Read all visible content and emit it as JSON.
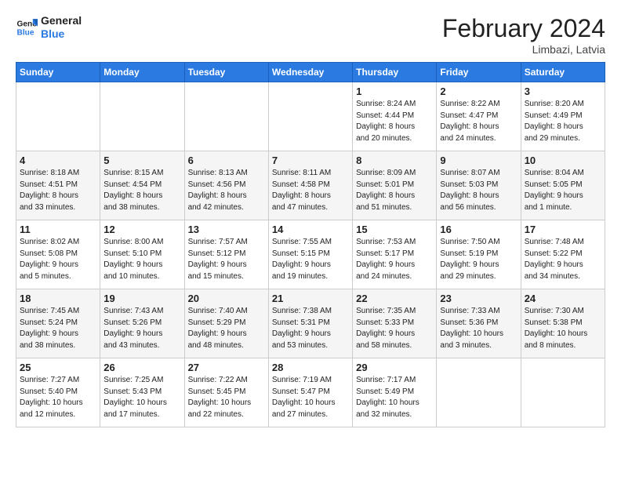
{
  "header": {
    "logo_line1": "General",
    "logo_line2": "Blue",
    "month_year": "February 2024",
    "location": "Limbazi, Latvia"
  },
  "weekdays": [
    "Sunday",
    "Monday",
    "Tuesday",
    "Wednesday",
    "Thursday",
    "Friday",
    "Saturday"
  ],
  "weeks": [
    [
      {
        "day": "",
        "info": ""
      },
      {
        "day": "",
        "info": ""
      },
      {
        "day": "",
        "info": ""
      },
      {
        "day": "",
        "info": ""
      },
      {
        "day": "1",
        "info": "Sunrise: 8:24 AM\nSunset: 4:44 PM\nDaylight: 8 hours\nand 20 minutes."
      },
      {
        "day": "2",
        "info": "Sunrise: 8:22 AM\nSunset: 4:47 PM\nDaylight: 8 hours\nand 24 minutes."
      },
      {
        "day": "3",
        "info": "Sunrise: 8:20 AM\nSunset: 4:49 PM\nDaylight: 8 hours\nand 29 minutes."
      }
    ],
    [
      {
        "day": "4",
        "info": "Sunrise: 8:18 AM\nSunset: 4:51 PM\nDaylight: 8 hours\nand 33 minutes."
      },
      {
        "day": "5",
        "info": "Sunrise: 8:15 AM\nSunset: 4:54 PM\nDaylight: 8 hours\nand 38 minutes."
      },
      {
        "day": "6",
        "info": "Sunrise: 8:13 AM\nSunset: 4:56 PM\nDaylight: 8 hours\nand 42 minutes."
      },
      {
        "day": "7",
        "info": "Sunrise: 8:11 AM\nSunset: 4:58 PM\nDaylight: 8 hours\nand 47 minutes."
      },
      {
        "day": "8",
        "info": "Sunrise: 8:09 AM\nSunset: 5:01 PM\nDaylight: 8 hours\nand 51 minutes."
      },
      {
        "day": "9",
        "info": "Sunrise: 8:07 AM\nSunset: 5:03 PM\nDaylight: 8 hours\nand 56 minutes."
      },
      {
        "day": "10",
        "info": "Sunrise: 8:04 AM\nSunset: 5:05 PM\nDaylight: 9 hours\nand 1 minute."
      }
    ],
    [
      {
        "day": "11",
        "info": "Sunrise: 8:02 AM\nSunset: 5:08 PM\nDaylight: 9 hours\nand 5 minutes."
      },
      {
        "day": "12",
        "info": "Sunrise: 8:00 AM\nSunset: 5:10 PM\nDaylight: 9 hours\nand 10 minutes."
      },
      {
        "day": "13",
        "info": "Sunrise: 7:57 AM\nSunset: 5:12 PM\nDaylight: 9 hours\nand 15 minutes."
      },
      {
        "day": "14",
        "info": "Sunrise: 7:55 AM\nSunset: 5:15 PM\nDaylight: 9 hours\nand 19 minutes."
      },
      {
        "day": "15",
        "info": "Sunrise: 7:53 AM\nSunset: 5:17 PM\nDaylight: 9 hours\nand 24 minutes."
      },
      {
        "day": "16",
        "info": "Sunrise: 7:50 AM\nSunset: 5:19 PM\nDaylight: 9 hours\nand 29 minutes."
      },
      {
        "day": "17",
        "info": "Sunrise: 7:48 AM\nSunset: 5:22 PM\nDaylight: 9 hours\nand 34 minutes."
      }
    ],
    [
      {
        "day": "18",
        "info": "Sunrise: 7:45 AM\nSunset: 5:24 PM\nDaylight: 9 hours\nand 38 minutes."
      },
      {
        "day": "19",
        "info": "Sunrise: 7:43 AM\nSunset: 5:26 PM\nDaylight: 9 hours\nand 43 minutes."
      },
      {
        "day": "20",
        "info": "Sunrise: 7:40 AM\nSunset: 5:29 PM\nDaylight: 9 hours\nand 48 minutes."
      },
      {
        "day": "21",
        "info": "Sunrise: 7:38 AM\nSunset: 5:31 PM\nDaylight: 9 hours\nand 53 minutes."
      },
      {
        "day": "22",
        "info": "Sunrise: 7:35 AM\nSunset: 5:33 PM\nDaylight: 9 hours\nand 58 minutes."
      },
      {
        "day": "23",
        "info": "Sunrise: 7:33 AM\nSunset: 5:36 PM\nDaylight: 10 hours\nand 3 minutes."
      },
      {
        "day": "24",
        "info": "Sunrise: 7:30 AM\nSunset: 5:38 PM\nDaylight: 10 hours\nand 8 minutes."
      }
    ],
    [
      {
        "day": "25",
        "info": "Sunrise: 7:27 AM\nSunset: 5:40 PM\nDaylight: 10 hours\nand 12 minutes."
      },
      {
        "day": "26",
        "info": "Sunrise: 7:25 AM\nSunset: 5:43 PM\nDaylight: 10 hours\nand 17 minutes."
      },
      {
        "day": "27",
        "info": "Sunrise: 7:22 AM\nSunset: 5:45 PM\nDaylight: 10 hours\nand 22 minutes."
      },
      {
        "day": "28",
        "info": "Sunrise: 7:19 AM\nSunset: 5:47 PM\nDaylight: 10 hours\nand 27 minutes."
      },
      {
        "day": "29",
        "info": "Sunrise: 7:17 AM\nSunset: 5:49 PM\nDaylight: 10 hours\nand 32 minutes."
      },
      {
        "day": "",
        "info": ""
      },
      {
        "day": "",
        "info": ""
      }
    ]
  ]
}
